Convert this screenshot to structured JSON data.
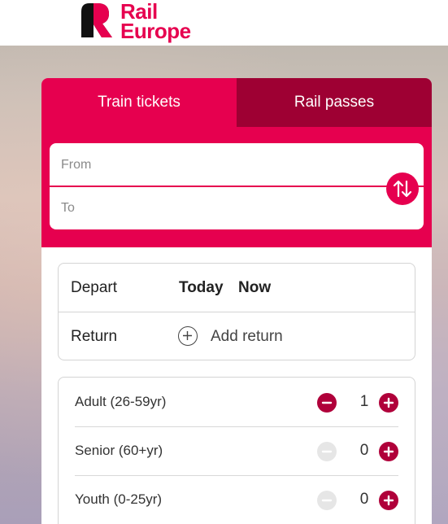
{
  "brand": {
    "name_line1": "Rail",
    "name_line2": "Europe",
    "color": "#e6004f"
  },
  "tabs": [
    {
      "label": "Train tickets",
      "active": true
    },
    {
      "label": "Rail passes",
      "active": false
    }
  ],
  "search": {
    "from_placeholder": "From",
    "to_placeholder": "To",
    "swap_icon": "swap-vertical-icon"
  },
  "dates": {
    "depart_label": "Depart",
    "depart_date": "Today",
    "depart_time": "Now",
    "return_label": "Return",
    "add_return_label": "Add return"
  },
  "passengers": [
    {
      "label": "Adult (26-59yr)",
      "count": "1",
      "minus_enabled": true
    },
    {
      "label": "Senior (60+yr)",
      "count": "0",
      "minus_enabled": false
    },
    {
      "label": "Youth (0-25yr)",
      "count": "0",
      "minus_enabled": false
    }
  ],
  "colors": {
    "accent": "#e6004f",
    "accent_dark": "#9e0033",
    "button": "#b0003a"
  }
}
